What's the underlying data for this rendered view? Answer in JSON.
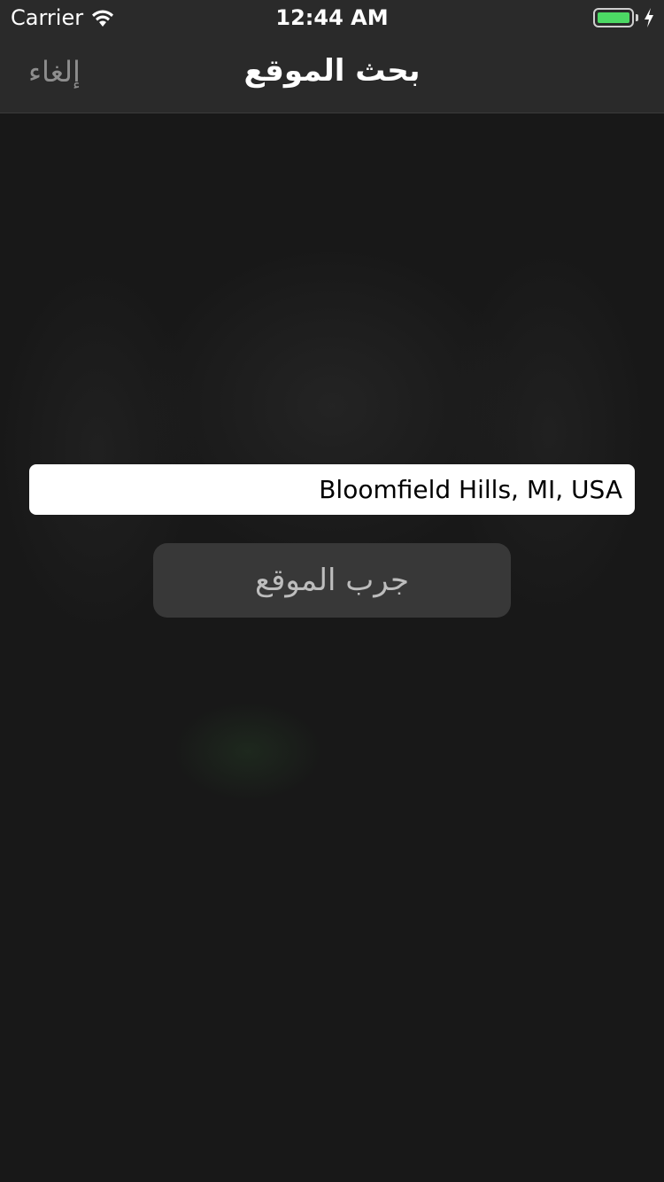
{
  "status_bar": {
    "carrier": "Carrier",
    "time": "12:44 AM",
    "wifi_icon": "wifi-icon",
    "battery_icon": "battery-icon",
    "battery_level": 1.0,
    "charging_icon": "bolt-icon",
    "battery_color": "#4cd964"
  },
  "nav": {
    "title": "بحث الموقع",
    "cancel_label": "إلغاء"
  },
  "search": {
    "value": "Bloomfield Hills, MI, USA"
  },
  "actions": {
    "try_location_label": "جرب الموقع"
  }
}
